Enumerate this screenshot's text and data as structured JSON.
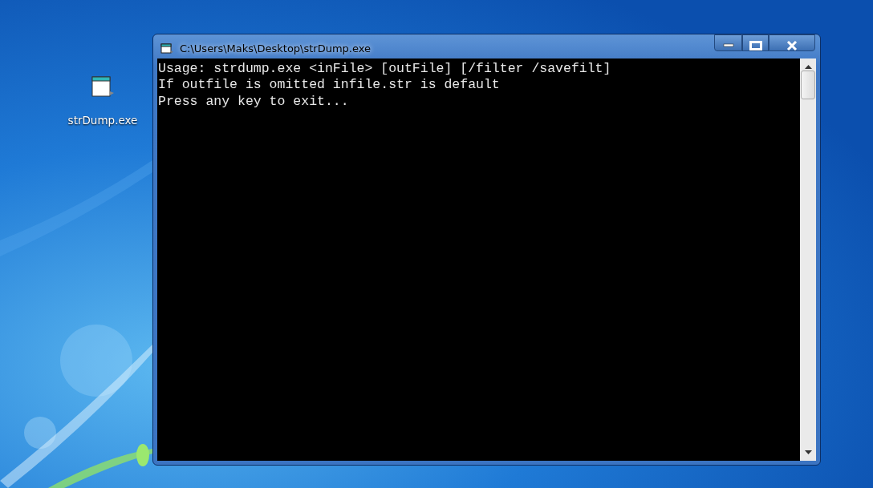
{
  "desktop_icons": [
    {
      "label": "strDump.exe",
      "selected": false
    }
  ],
  "window": {
    "title": "C:\\Users\\Maks\\Desktop\\strDump.exe",
    "active": true
  },
  "console": {
    "lines": [
      "Usage: strdump.exe <inFile> [outFile] [/filter /savefilt]",
      "If outfile is omitted infile.str is default",
      "Press any key to exit..."
    ]
  }
}
